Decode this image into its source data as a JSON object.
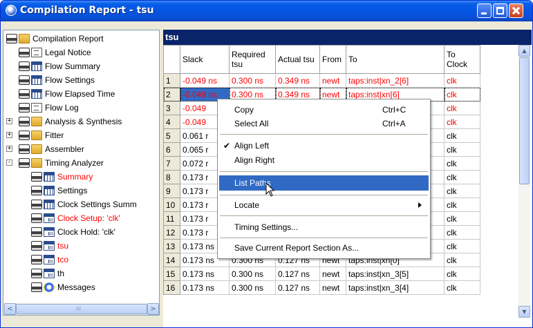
{
  "window": {
    "title": "Compilation Report - tsu"
  },
  "tree": {
    "items": [
      {
        "label": "Compilation Report",
        "icon": "printer-folder-icon",
        "color": "#000000"
      },
      {
        "label": "Legal Notice",
        "icon": "printer-doc-icon",
        "color": "#000000"
      },
      {
        "label": "Flow Summary",
        "icon": "printer-grid-icon",
        "color": "#000000"
      },
      {
        "label": "Flow Settings",
        "icon": "printer-grid-icon",
        "color": "#000000"
      },
      {
        "label": "Flow Elapsed Time",
        "icon": "printer-grid-icon",
        "color": "#000000"
      },
      {
        "label": "Flow Log",
        "icon": "printer-doc-icon",
        "color": "#000000"
      },
      {
        "label": "Analysis & Synthesis",
        "icon": "printer-folder-icon",
        "color": "#000000"
      },
      {
        "label": "Fitter",
        "icon": "printer-folder-icon",
        "color": "#000000"
      },
      {
        "label": "Assembler",
        "icon": "printer-folder-icon",
        "color": "#000000"
      },
      {
        "label": "Timing Analyzer",
        "icon": "printer-folder-icon",
        "color": "#000000"
      },
      {
        "label": "Summary",
        "icon": "printer-grid-icon",
        "color": "#ff0000"
      },
      {
        "label": "Settings",
        "icon": "printer-grid-icon",
        "color": "#000000"
      },
      {
        "label": "Clock Settings Summ",
        "icon": "printer-grid-icon",
        "color": "#000000"
      },
      {
        "label": "Clock Setup: 'clk'",
        "icon": "printer-clock-icon",
        "color": "#ff0000"
      },
      {
        "label": "Clock Hold: 'clk'",
        "icon": "printer-clock-icon",
        "color": "#000000"
      },
      {
        "label": "tsu",
        "icon": "printer-clock-icon",
        "color": "#ff0000"
      },
      {
        "label": "tco",
        "icon": "printer-clock-icon",
        "color": "#ff0000"
      },
      {
        "label": "th",
        "icon": "printer-clock-icon",
        "color": "#000000"
      },
      {
        "label": "Messages",
        "icon": "printer-info-icon",
        "color": "#000000"
      }
    ],
    "hscroll_labels": {
      "left": "<",
      "right": ">",
      "grip": "III"
    }
  },
  "report": {
    "title": "tsu",
    "columns": [
      "Slack",
      "Required tsu",
      "Actual tsu",
      "From",
      "To",
      "To Clock"
    ],
    "rows": [
      {
        "n": "1",
        "slack": "-0.049 ns",
        "req": "0.300 ns",
        "act": "0.349 ns",
        "from": "newt",
        "to": "taps:inst|xn_2[6]",
        "clk": "clk",
        "red": true
      },
      {
        "n": "2",
        "slack": "-0.049 ns",
        "req": "0.300 ns",
        "act": "0.349 ns",
        "from": "newt",
        "to": "taps:inst|xn[6]",
        "clk": "clk",
        "red": true
      },
      {
        "n": "3",
        "slack": "-0.049",
        "req": "",
        "act": "",
        "from": "",
        "to": "",
        "clk": "clk",
        "red": true
      },
      {
        "n": "4",
        "slack": "-0.049",
        "req": "",
        "act": "",
        "from": "",
        "to": "",
        "clk": "clk",
        "red": true
      },
      {
        "n": "5",
        "slack": "0.061 r",
        "req": "",
        "act": "",
        "from": "",
        "to": "ap1",
        "clk": "clk",
        "red": false
      },
      {
        "n": "6",
        "slack": "0.065 r",
        "req": "",
        "act": "",
        "from": "",
        "to": "dle",
        "clk": "clk",
        "red": false
      },
      {
        "n": "7",
        "slack": "0.072 r",
        "req": "",
        "act": "",
        "from": "",
        "to": "",
        "clk": "clk",
        "red": false
      },
      {
        "n": "8",
        "slack": "0.173 r",
        "req": "",
        "act": "",
        "from": "",
        "to": "",
        "clk": "clk",
        "red": false
      },
      {
        "n": "9",
        "slack": "0.173 r",
        "req": "",
        "act": "",
        "from": "",
        "to": "",
        "clk": "clk",
        "red": false
      },
      {
        "n": "10",
        "slack": "0.173 r",
        "req": "",
        "act": "",
        "from": "",
        "to": "",
        "clk": "clk",
        "red": false
      },
      {
        "n": "11",
        "slack": "0.173 r",
        "req": "",
        "act": "",
        "from": "",
        "to": "",
        "clk": "clk",
        "red": false
      },
      {
        "n": "12",
        "slack": "0.173 r",
        "req": "",
        "act": "",
        "from": "",
        "to": "",
        "clk": "clk",
        "red": false
      },
      {
        "n": "13",
        "slack": "0.173 ns",
        "req": "0.300 ns",
        "act": "0.127 ns",
        "from": "newt",
        "to": "taps:inst|xn_2[0]",
        "clk": "clk",
        "red": false
      },
      {
        "n": "14",
        "slack": "0.173 ns",
        "req": "0.300 ns",
        "act": "0.127 ns",
        "from": "newt",
        "to": "taps:inst|xn[0]",
        "clk": "clk",
        "red": false
      },
      {
        "n": "15",
        "slack": "0.173 ns",
        "req": "0.300 ns",
        "act": "0.127 ns",
        "from": "newt",
        "to": "taps:inst|xn_3[5]",
        "clk": "clk",
        "red": false
      },
      {
        "n": "16",
        "slack": "0.173 ns",
        "req": "0.300 ns",
        "act": "0.127 ns",
        "from": "newt",
        "to": "taps:inst|xn_3[4]",
        "clk": "clk",
        "red": false
      }
    ]
  },
  "context_menu": {
    "copy": "Copy",
    "copy_shortcut": "Ctrl+C",
    "select_all": "Select All",
    "select_all_shortcut": "Ctrl+A",
    "align_left": "Align Left",
    "align_right": "Align Right",
    "list_paths": "List Paths",
    "locate": "Locate",
    "timing_settings": "Timing Settings...",
    "save_section": "Save Current Report Section As..."
  },
  "colors": {
    "title_bar": "#0555e3",
    "pane_header": "#0a246a",
    "highlight": "#316ac5",
    "warning_text": "#ff0000"
  }
}
